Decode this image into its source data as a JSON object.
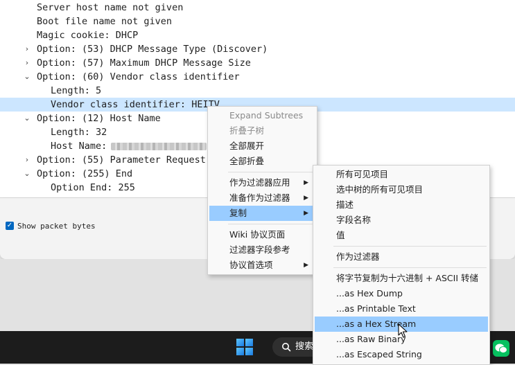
{
  "tree": {
    "rows": [
      {
        "text": "Server host name not given",
        "arrow": ""
      },
      {
        "text": "Boot file name not given",
        "arrow": ""
      },
      {
        "text": "Magic cookie: DHCP",
        "arrow": ""
      },
      {
        "text": "Option: (53) DHCP Message Type (Discover)",
        "arrow": "›"
      },
      {
        "text": "Option: (57) Maximum DHCP Message Size",
        "arrow": "›"
      },
      {
        "text": "Option: (60) Vendor class identifier",
        "arrow": "⌄"
      },
      {
        "text": "Length: 5",
        "arrow": ""
      },
      {
        "text": "Vendor class identifier: HEITV",
        "arrow": ""
      },
      {
        "text": "Option: (12) Host Name",
        "arrow": "⌄"
      },
      {
        "text": "Length: 32",
        "arrow": ""
      },
      {
        "text": "Host Name:",
        "arrow": ""
      },
      {
        "text": "Option: (55) Parameter Request",
        "arrow": "›"
      },
      {
        "text": "Option: (255) End",
        "arrow": "⌄"
      },
      {
        "text": "Option End: 255",
        "arrow": ""
      }
    ]
  },
  "bottom_panel": {
    "show_packet_bytes_label": "Show packet bytes",
    "show_packet_bytes_checked": true
  },
  "context_menu": {
    "items": [
      {
        "label": "Expand Subtrees",
        "disabled": true
      },
      {
        "label": "折叠子树",
        "disabled": true
      },
      {
        "label": "全部展开"
      },
      {
        "label": "全部折叠"
      },
      {
        "label": "作为过滤器应用",
        "submenu": true
      },
      {
        "label": "准备作为过滤器",
        "submenu": true
      },
      {
        "label": "复制",
        "submenu": true,
        "highlighted": true
      },
      {
        "label": "Wiki 协议页面"
      },
      {
        "label": "过滤器字段参考"
      },
      {
        "label": "协议首选项",
        "submenu": true
      }
    ]
  },
  "copy_submenu": {
    "items": [
      {
        "label": "所有可见项目"
      },
      {
        "label": "选中树的所有可见项目"
      },
      {
        "label": "描述"
      },
      {
        "label": "字段名称"
      },
      {
        "label": "值"
      },
      {
        "label": "作为过滤器"
      },
      {
        "label": "将字节复制为十六进制 + ASCII 转储"
      },
      {
        "label": "...as Hex Dump"
      },
      {
        "label": "...as Printable Text"
      },
      {
        "label": "...as a Hex Stream",
        "highlighted": true
      },
      {
        "label": "...as Raw Binary"
      },
      {
        "label": "...as Escaped String"
      }
    ]
  },
  "taskbar": {
    "search_label": "搜索",
    "search_icon": "search-icon",
    "start_icon": "windows-logo-icon",
    "tray_app_icon": "wechat-icon"
  },
  "colors": {
    "selection_row": "#cce6ff",
    "menu_highlight": "#99ccff",
    "taskbar": "#1c1c1c",
    "checkbox_accent": "#0067c0"
  }
}
